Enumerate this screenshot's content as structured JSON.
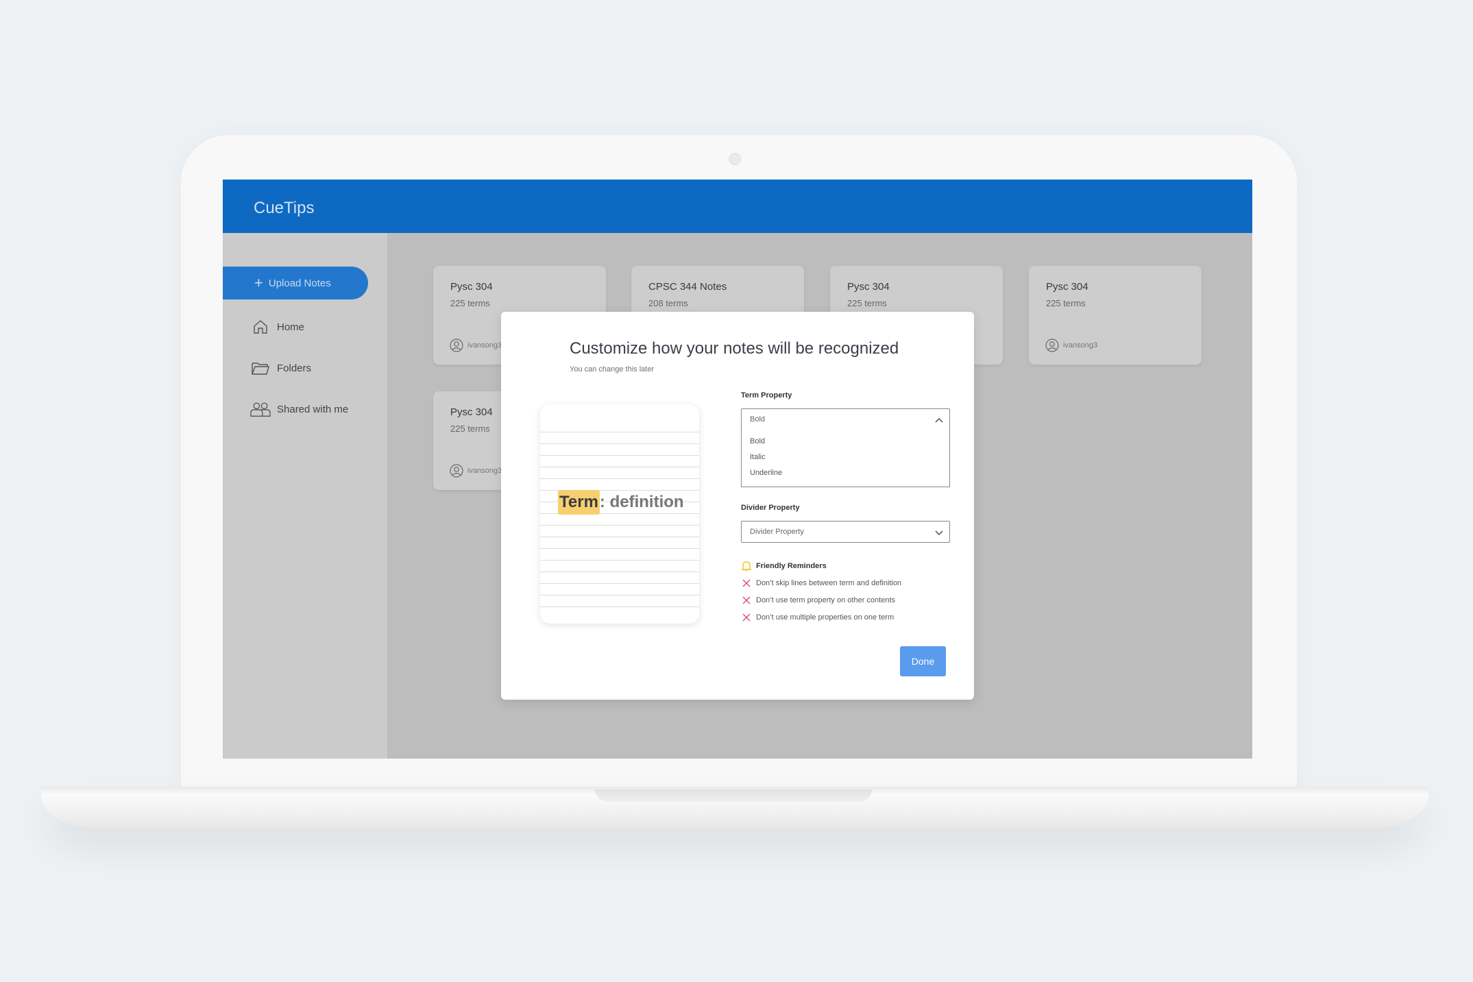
{
  "app": {
    "title": "CueTips"
  },
  "sidebar": {
    "upload_label": "Upload Notes",
    "items": [
      {
        "label": "Home",
        "icon": "home-icon"
      },
      {
        "label": "Folders",
        "icon": "folder-icon"
      },
      {
        "label": "Shared with me",
        "icon": "people-icon"
      }
    ]
  },
  "cards": [
    {
      "title": "Pysc 304",
      "count": "225 terms",
      "user": "ivansong3"
    },
    {
      "title": "CPSC 344 Notes",
      "count": "208 terms",
      "user": ""
    },
    {
      "title": "Pysc 304",
      "count": "225 terms",
      "user": ""
    },
    {
      "title": "Pysc 304",
      "count": "225 terms",
      "user": "ivansong3"
    },
    {
      "title": "Pysc 304",
      "count": "225 terms",
      "user": "ivansong3"
    }
  ],
  "modal": {
    "title": "Customize how your notes will be recognized",
    "subtitle": "You can change this later",
    "preview_term": "Term",
    "preview_sep": ":",
    "preview_definition": " definition",
    "term_property": {
      "label": "Term Property",
      "value": "Bold",
      "options": [
        "Bold",
        "Italic",
        "Underline"
      ]
    },
    "divider_property": {
      "label": "Divider Property",
      "value": "Divider Property"
    },
    "reminders": {
      "heading": "Friendly Reminders",
      "items": [
        "Don’t skip lines between term and definition",
        "Don’t use term property on other contents",
        "Don’t use multiple properties on one term"
      ]
    },
    "done_label": "Done"
  },
  "colors": {
    "brand": "#0e69c2",
    "upload": "#2378cd",
    "done": "#5a9bee",
    "highlight": "#f6cf71",
    "warning": "#e0496c",
    "bell": "#f0c419"
  }
}
